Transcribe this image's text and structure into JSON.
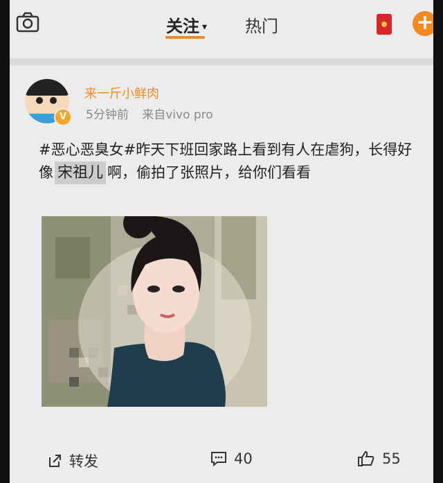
{
  "header": {
    "tabs": [
      {
        "label": "关注",
        "active": true
      },
      {
        "label": "热门",
        "active": false
      }
    ],
    "caret": "▾",
    "add_button": "+"
  },
  "post": {
    "username": "来一斤小鲜肉",
    "verified_badge": "V",
    "time": "5分钟前",
    "source": "来自vivo pro",
    "text_before": "#恶心恶臭女#昨天下班回家路上看到有人在虐狗，长得好像",
    "celebrity_label": "宋祖儿",
    "text_after": "啊，偷拍了张照片，给你们看看"
  },
  "actions": {
    "repost_label": "转发",
    "comment_count": "40",
    "like_count": "55"
  },
  "colors": {
    "accent": "#f5891f",
    "username": "#f08a23",
    "red_packet": "#d8262b"
  }
}
